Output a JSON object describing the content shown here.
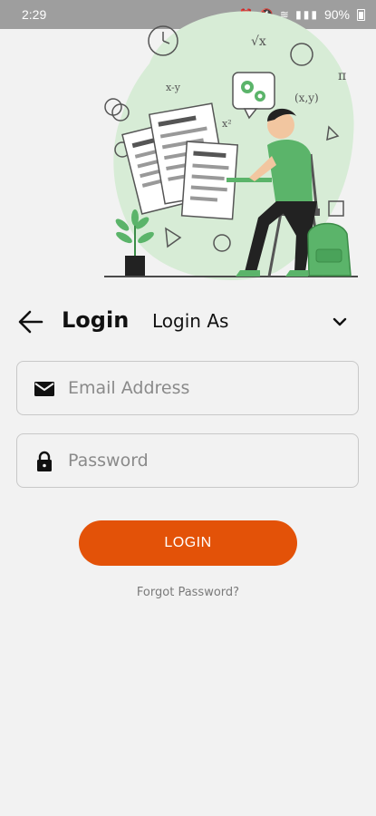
{
  "status_bar": {
    "time": "2:29",
    "battery": "90%"
  },
  "illustration": {
    "icon": "student-studying-illustration",
    "math_symbols": [
      "√x",
      "x-y",
      "x²",
      "(x,y)",
      "π"
    ]
  },
  "header": {
    "title": "Login",
    "role_select_label": "Login As"
  },
  "form": {
    "email_placeholder": "Email Address",
    "email_value": "",
    "password_placeholder": "Password",
    "password_value": "",
    "login_button_label": "LOGIN",
    "forgot_password_label": "Forgot Password?"
  },
  "colors": {
    "accent": "#e35208",
    "illustration_green": "#5bb46a",
    "background": "#f2f2f2"
  }
}
